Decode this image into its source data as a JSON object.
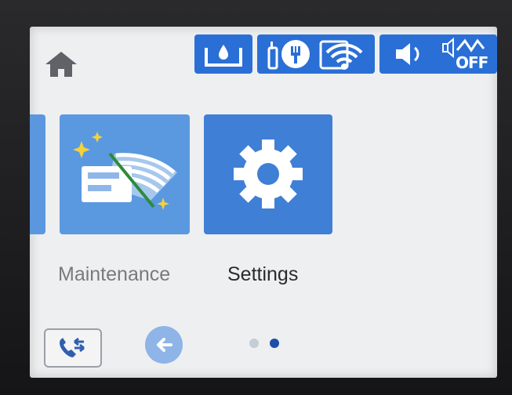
{
  "status_bar": {
    "icons": [
      "home-icon",
      "ink-level-icon",
      "wifi-direct-icon",
      "wifi-icon",
      "sound-icon",
      "quiet-mode-icon"
    ],
    "quiet_mode_text": "OFF"
  },
  "tiles": [
    {
      "label": "",
      "icon": "partial-tile"
    },
    {
      "label": "Maintenance",
      "icon": "maintenance-icon"
    },
    {
      "label": "Settings",
      "icon": "gear-icon"
    }
  ],
  "pagination": {
    "current": 2,
    "total": 2
  },
  "colors": {
    "accent": "#2a6fd6",
    "tile": "#3f86d8",
    "screen_bg": "#eeeff0",
    "active_dot": "#1d4ea8"
  }
}
